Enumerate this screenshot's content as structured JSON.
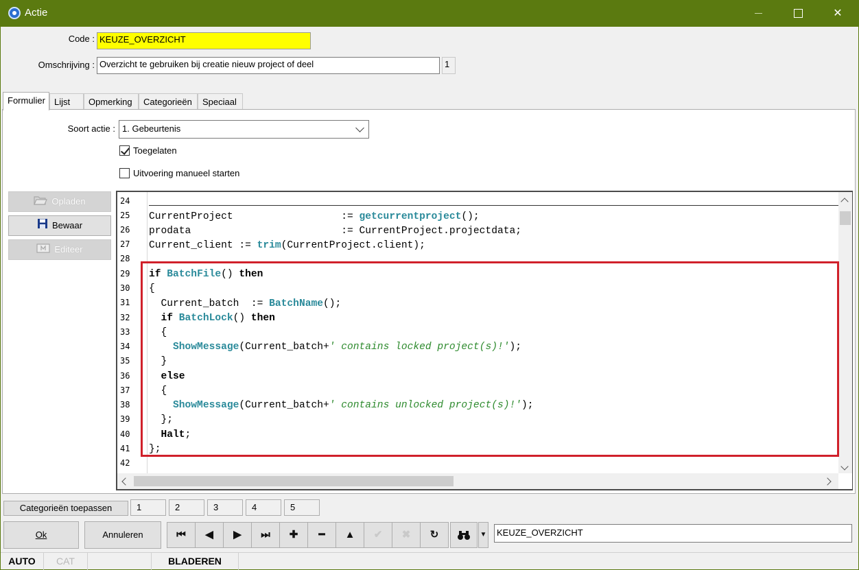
{
  "window": {
    "title": "Actie"
  },
  "header": {
    "code_label": "Code :",
    "code_value": "KEUZE_OVERZICHT",
    "desc_label": "Omschrijving :",
    "desc_value": "Overzicht te gebruiken bij creatie nieuw project of deel",
    "desc_counter": "1"
  },
  "tabs": [
    {
      "label": "Formulier",
      "active": true
    },
    {
      "label": "Lijst"
    },
    {
      "label": "Opmerking"
    },
    {
      "label": "Categorieën"
    },
    {
      "label": "Speciaal"
    }
  ],
  "form": {
    "soort_label": "Soort actie :",
    "soort_value": "1.  Gebeurtenis",
    "toegelaten_label": "Toegelaten",
    "toegelaten_checked": true,
    "manueel_label": "Uitvoering manueel starten",
    "manueel_checked": false
  },
  "side_buttons": {
    "opladen": "Opladen",
    "bewaar": "Bewaar",
    "editeer": "Editeer"
  },
  "code": {
    "line_numbers": [
      "24",
      "25",
      "26",
      "27",
      "28",
      "29",
      "30",
      "31",
      "32",
      "33",
      "34",
      "35",
      "36",
      "37",
      "38",
      "39",
      "40",
      "41",
      "42"
    ]
  },
  "bottom": {
    "categories_apply": "Categorieën toepassen",
    "pages": [
      "1",
      "2",
      "3",
      "4",
      "5"
    ],
    "ok": "Ok",
    "cancel": "Annuleren",
    "search_value": "KEUZE_OVERZICHT"
  },
  "status": {
    "auto": "AUTO",
    "cat": "CAT",
    "mode": "BLADEREN"
  },
  "colors": {
    "titlebar": "#5b7a10",
    "code_highlight": "#ffff00",
    "annotation_box": "#d0202a",
    "function_color": "#2a8a9a",
    "string_color": "#2d8a2d"
  }
}
